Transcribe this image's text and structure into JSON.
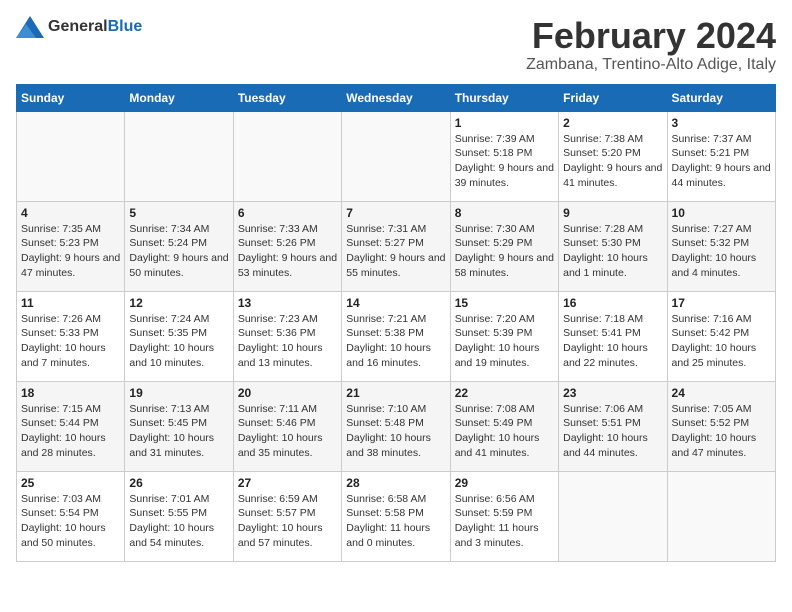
{
  "logo": {
    "general": "General",
    "blue": "Blue"
  },
  "title": "February 2024",
  "subtitle": "Zambana, Trentino-Alto Adige, Italy",
  "weekdays": [
    "Sunday",
    "Monday",
    "Tuesday",
    "Wednesday",
    "Thursday",
    "Friday",
    "Saturday"
  ],
  "weeks": [
    [
      {
        "day": "",
        "info": ""
      },
      {
        "day": "",
        "info": ""
      },
      {
        "day": "",
        "info": ""
      },
      {
        "day": "",
        "info": ""
      },
      {
        "day": "1",
        "info": "Sunrise: 7:39 AM\nSunset: 5:18 PM\nDaylight: 9 hours and 39 minutes."
      },
      {
        "day": "2",
        "info": "Sunrise: 7:38 AM\nSunset: 5:20 PM\nDaylight: 9 hours and 41 minutes."
      },
      {
        "day": "3",
        "info": "Sunrise: 7:37 AM\nSunset: 5:21 PM\nDaylight: 9 hours and 44 minutes."
      }
    ],
    [
      {
        "day": "4",
        "info": "Sunrise: 7:35 AM\nSunset: 5:23 PM\nDaylight: 9 hours and 47 minutes."
      },
      {
        "day": "5",
        "info": "Sunrise: 7:34 AM\nSunset: 5:24 PM\nDaylight: 9 hours and 50 minutes."
      },
      {
        "day": "6",
        "info": "Sunrise: 7:33 AM\nSunset: 5:26 PM\nDaylight: 9 hours and 53 minutes."
      },
      {
        "day": "7",
        "info": "Sunrise: 7:31 AM\nSunset: 5:27 PM\nDaylight: 9 hours and 55 minutes."
      },
      {
        "day": "8",
        "info": "Sunrise: 7:30 AM\nSunset: 5:29 PM\nDaylight: 9 hours and 58 minutes."
      },
      {
        "day": "9",
        "info": "Sunrise: 7:28 AM\nSunset: 5:30 PM\nDaylight: 10 hours and 1 minute."
      },
      {
        "day": "10",
        "info": "Sunrise: 7:27 AM\nSunset: 5:32 PM\nDaylight: 10 hours and 4 minutes."
      }
    ],
    [
      {
        "day": "11",
        "info": "Sunrise: 7:26 AM\nSunset: 5:33 PM\nDaylight: 10 hours and 7 minutes."
      },
      {
        "day": "12",
        "info": "Sunrise: 7:24 AM\nSunset: 5:35 PM\nDaylight: 10 hours and 10 minutes."
      },
      {
        "day": "13",
        "info": "Sunrise: 7:23 AM\nSunset: 5:36 PM\nDaylight: 10 hours and 13 minutes."
      },
      {
        "day": "14",
        "info": "Sunrise: 7:21 AM\nSunset: 5:38 PM\nDaylight: 10 hours and 16 minutes."
      },
      {
        "day": "15",
        "info": "Sunrise: 7:20 AM\nSunset: 5:39 PM\nDaylight: 10 hours and 19 minutes."
      },
      {
        "day": "16",
        "info": "Sunrise: 7:18 AM\nSunset: 5:41 PM\nDaylight: 10 hours and 22 minutes."
      },
      {
        "day": "17",
        "info": "Sunrise: 7:16 AM\nSunset: 5:42 PM\nDaylight: 10 hours and 25 minutes."
      }
    ],
    [
      {
        "day": "18",
        "info": "Sunrise: 7:15 AM\nSunset: 5:44 PM\nDaylight: 10 hours and 28 minutes."
      },
      {
        "day": "19",
        "info": "Sunrise: 7:13 AM\nSunset: 5:45 PM\nDaylight: 10 hours and 31 minutes."
      },
      {
        "day": "20",
        "info": "Sunrise: 7:11 AM\nSunset: 5:46 PM\nDaylight: 10 hours and 35 minutes."
      },
      {
        "day": "21",
        "info": "Sunrise: 7:10 AM\nSunset: 5:48 PM\nDaylight: 10 hours and 38 minutes."
      },
      {
        "day": "22",
        "info": "Sunrise: 7:08 AM\nSunset: 5:49 PM\nDaylight: 10 hours and 41 minutes."
      },
      {
        "day": "23",
        "info": "Sunrise: 7:06 AM\nSunset: 5:51 PM\nDaylight: 10 hours and 44 minutes."
      },
      {
        "day": "24",
        "info": "Sunrise: 7:05 AM\nSunset: 5:52 PM\nDaylight: 10 hours and 47 minutes."
      }
    ],
    [
      {
        "day": "25",
        "info": "Sunrise: 7:03 AM\nSunset: 5:54 PM\nDaylight: 10 hours and 50 minutes."
      },
      {
        "day": "26",
        "info": "Sunrise: 7:01 AM\nSunset: 5:55 PM\nDaylight: 10 hours and 54 minutes."
      },
      {
        "day": "27",
        "info": "Sunrise: 6:59 AM\nSunset: 5:57 PM\nDaylight: 10 hours and 57 minutes."
      },
      {
        "day": "28",
        "info": "Sunrise: 6:58 AM\nSunset: 5:58 PM\nDaylight: 11 hours and 0 minutes."
      },
      {
        "day": "29",
        "info": "Sunrise: 6:56 AM\nSunset: 5:59 PM\nDaylight: 11 hours and 3 minutes."
      },
      {
        "day": "",
        "info": ""
      },
      {
        "day": "",
        "info": ""
      }
    ]
  ]
}
